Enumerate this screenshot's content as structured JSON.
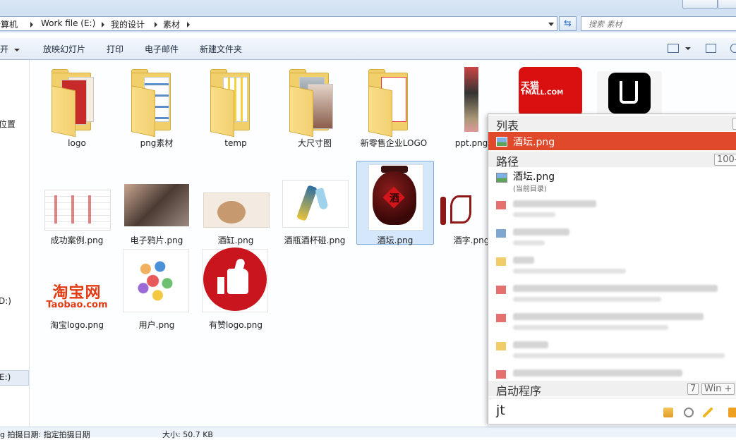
{
  "breadcrumb": {
    "parts": [
      "计算机",
      "Work file (E:)",
      "我的设计",
      "素材"
    ]
  },
  "search": {
    "placeholder": "搜索 素材"
  },
  "toolbar": {
    "open_label": "开",
    "slideshow_label": "放映幻灯片",
    "print_label": "打印",
    "email_label": "电子邮件",
    "new_folder_label": "新建文件夹"
  },
  "nav": {
    "location_label": "位置",
    "drive1_label": "D:)",
    "drive2_label": "E:)"
  },
  "files": [
    {
      "name": "logo",
      "kind": "folder"
    },
    {
      "name": "png素材",
      "kind": "folder"
    },
    {
      "name": "temp",
      "kind": "folder"
    },
    {
      "name": "大尺寸图",
      "kind": "folder"
    },
    {
      "name": "新零售企业LOGO",
      "kind": "folder"
    },
    {
      "name": "ppt.png",
      "kind": "image"
    },
    {
      "name": "成功案例.png",
      "kind": "image"
    },
    {
      "name": "电子鸦片.png",
      "kind": "image"
    },
    {
      "name": "酒缸.png",
      "kind": "image"
    },
    {
      "name": "酒瓶酒杯碰.png",
      "kind": "image"
    },
    {
      "name": "酒坛.png",
      "kind": "image",
      "selected": true
    },
    {
      "name": "酒字.png",
      "kind": "image"
    },
    {
      "name": "淘宝logo.png",
      "kind": "image"
    },
    {
      "name": "用户.png",
      "kind": "image"
    },
    {
      "name": "有赞logo.png",
      "kind": "image"
    }
  ],
  "thumb_text": {
    "tmall_line1": "天猫",
    "tmall_line2": "TMALL.COM",
    "taobao_line1": "淘宝网",
    "taobao_line2": "Taobao.com",
    "jiu_char": "酒"
  },
  "status": {
    "left_text": "g 拍摄日期: 指定拍摄日期",
    "size_text": "大小: 50.7 KB"
  },
  "popup": {
    "list_header": "列表",
    "list_selected": "酒坛.png",
    "path_header": "路径",
    "path_hint": "100-",
    "path_item_name": "酒坛.png",
    "path_item_sub": "(当前目录)",
    "launch_header": "启动程序",
    "launch_hint_num": "7",
    "launch_hint_win": "Win +",
    "query": "jt",
    "accent_color": "#e04a2a"
  }
}
